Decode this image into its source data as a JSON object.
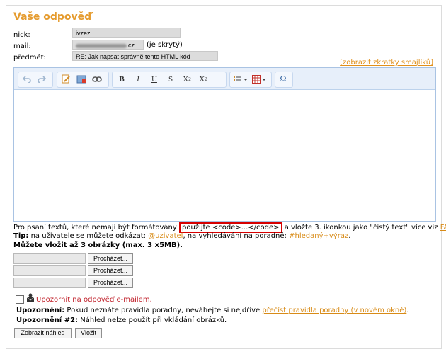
{
  "title": "Vaše odpověď",
  "form": {
    "nick_label": "nick:",
    "nick_value": "ivzez",
    "mail_label": "mail:",
    "mail_value": "cz",
    "mail_note": "(je skrytý)",
    "subject_label": "předmět:",
    "subject_value": "RE: Jak napsat správně tento HTML kód"
  },
  "smiley_link": "[zobrazit zkratky smajlíků]",
  "toolbar": {
    "undo": "undo-icon",
    "redo": "redo-icon",
    "bold": "B",
    "italic": "I",
    "underline": "U",
    "strike": "S",
    "subscript": "X",
    "subscript_mark": "2",
    "superscript": "X",
    "superscript_mark": "2",
    "omega": "Ω"
  },
  "hints": {
    "line1_before": "Pro psaní textů, které nemají být formátovány",
    "line1_code": "použijte <code>...</code>",
    "line1_after": "a vložte 3. ikonkou jako \"čistý text\" více viz",
    "line1_faq": "FAQ",
    "line2_tip": "Tip:",
    "line2_a": "na uživatele se můžete odkázat:",
    "line2_user": "@uzivatel",
    "line2_b": ", na vyhledávání na poradně:",
    "line2_search": "#hledaný+výraz",
    "line2_end": ".",
    "images_note": "Můžete vložit až 3 obrázky (max. 3 x5MB)."
  },
  "file_inputs": [
    {
      "browse_label": "Procházet..."
    },
    {
      "browse_label": "Procházet..."
    },
    {
      "browse_label": "Procházet..."
    }
  ],
  "notify_label": "Upozornit na odpověď e-mailem.",
  "warnings": {
    "w1_label": "Upozornění:",
    "w1_text": "Pokud neznáte pravidla poradny, neváhejte si nejdříve",
    "w1_link": "přečíst pravidla poradny (v novém okně)",
    "w1_end": ".",
    "w2_label": "Upozornění #2:",
    "w2_text": "Náhled nelze použít při vkládání obrázků."
  },
  "buttons": {
    "preview": "Zobrazit náhled",
    "submit": "Vložit"
  }
}
